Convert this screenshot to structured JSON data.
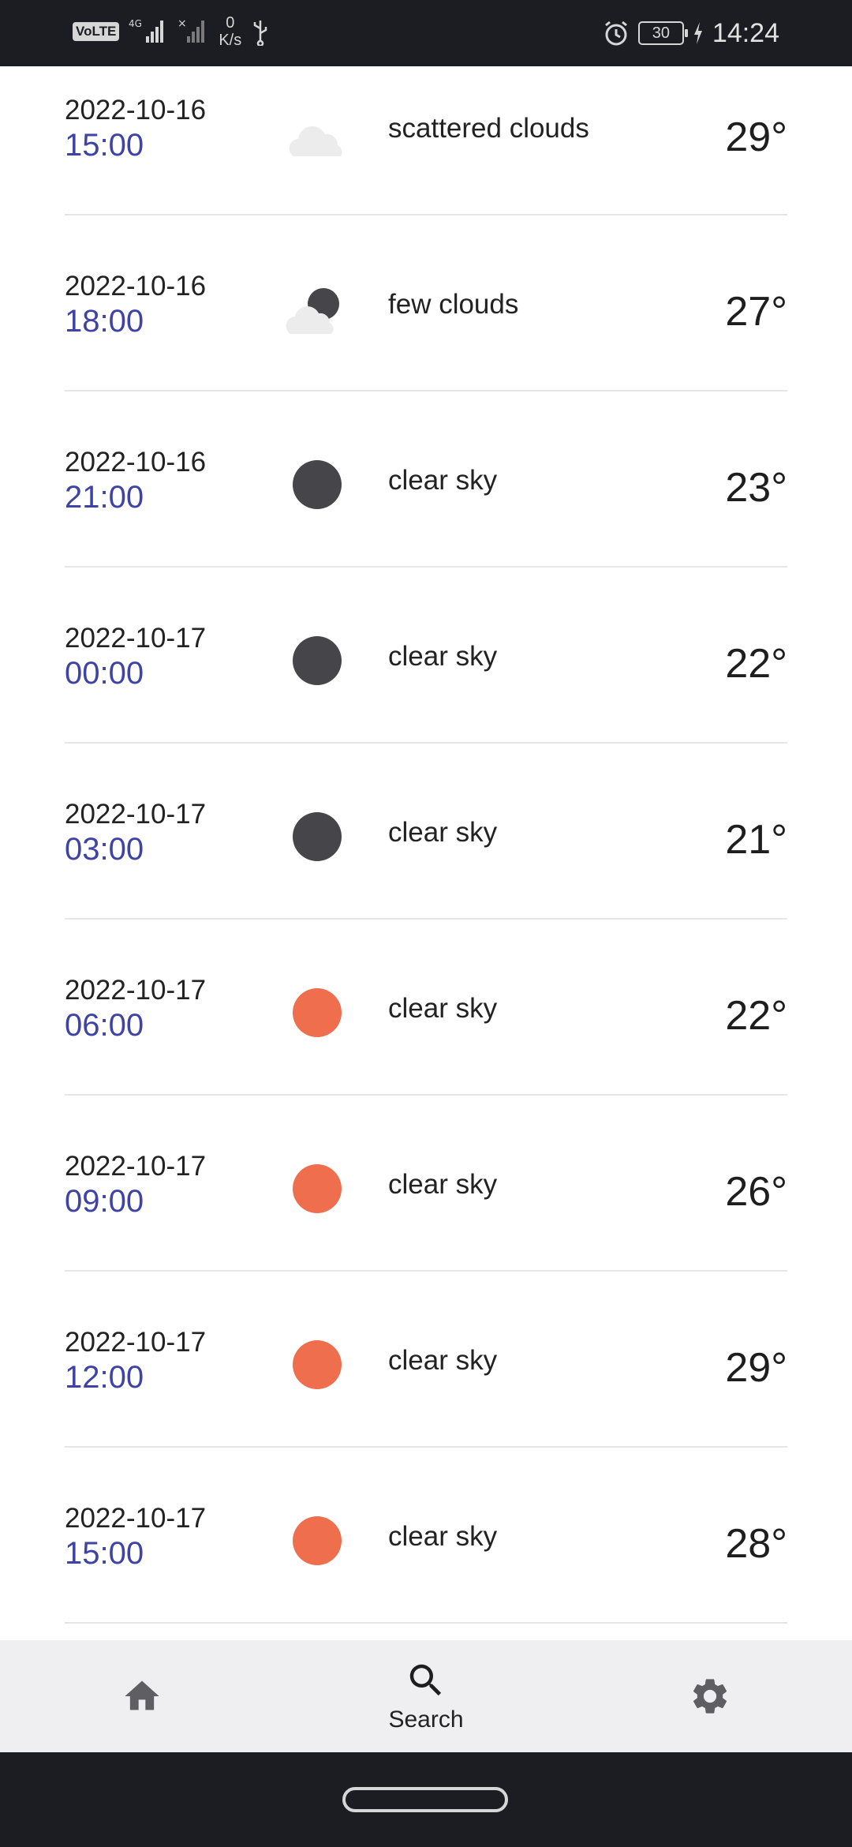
{
  "status_bar": {
    "volte": "VoLTE",
    "network": "4G",
    "speed_value": "0",
    "speed_unit": "K/s",
    "battery": "30",
    "time": "14:24"
  },
  "forecast": [
    {
      "date": "2022-10-16",
      "hour": "15:00",
      "icon": "scattered-clouds-icon",
      "description": "scattered clouds",
      "temp": "29°"
    },
    {
      "date": "2022-10-16",
      "hour": "18:00",
      "icon": "few-clouds-night-icon",
      "description": "few clouds",
      "temp": "27°"
    },
    {
      "date": "2022-10-16",
      "hour": "21:00",
      "icon": "clear-night-icon",
      "description": "clear sky",
      "temp": "23°"
    },
    {
      "date": "2022-10-17",
      "hour": "00:00",
      "icon": "clear-night-icon",
      "description": "clear sky",
      "temp": "22°"
    },
    {
      "date": "2022-10-17",
      "hour": "03:00",
      "icon": "clear-night-icon",
      "description": "clear sky",
      "temp": "21°"
    },
    {
      "date": "2022-10-17",
      "hour": "06:00",
      "icon": "clear-day-icon",
      "description": "clear sky",
      "temp": "22°"
    },
    {
      "date": "2022-10-17",
      "hour": "09:00",
      "icon": "clear-day-icon",
      "description": "clear sky",
      "temp": "26°"
    },
    {
      "date": "2022-10-17",
      "hour": "12:00",
      "icon": "clear-day-icon",
      "description": "clear sky",
      "temp": "29°"
    },
    {
      "date": "2022-10-17",
      "hour": "15:00",
      "icon": "clear-day-icon",
      "description": "clear sky",
      "temp": "28°"
    }
  ],
  "bottom_nav": {
    "home_icon": "home-icon",
    "search_label": "Search",
    "settings_icon": "gear-icon"
  },
  "colors": {
    "time_accent": "#3f43a6",
    "sun": "#ee6e4d",
    "moon": "#46464a",
    "cloud": "#ececec"
  }
}
